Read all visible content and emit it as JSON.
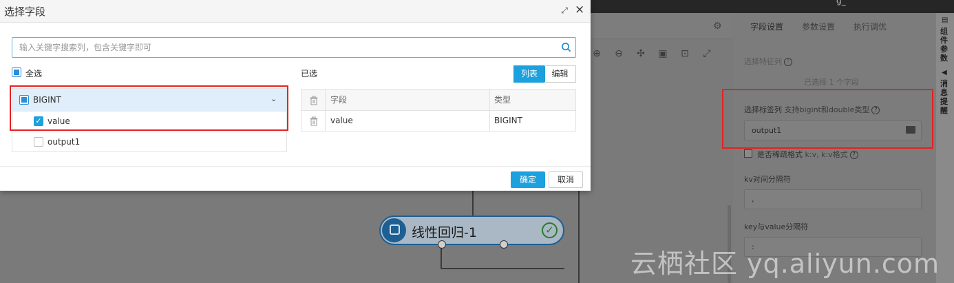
{
  "app": {
    "window_title": "g_",
    "right_panel": {
      "tabs": [
        "字段设置",
        "参数设置",
        "执行调优"
      ],
      "feature_label": "选择特征列",
      "feature_status": "已选择 1 个字段",
      "label_col_title": "选择标签列",
      "label_col_hint": "支持bigint和double类型",
      "label_col_value": "output1",
      "sparse_label": "是否稀疏格式",
      "sparse_hint": "k:v, k:v格式",
      "kv_sep_label": "kv对间分隔符",
      "kv_sep_value": ",",
      "key_value_sep_label": "key与value分隔符",
      "key_value_sep_value": ":"
    },
    "sidebar": {
      "item1": "组件参数",
      "item2": "消息提醒"
    },
    "node": {
      "label": "线性回归-1",
      "status": "✓"
    },
    "watermark": "云栖社区 yq.aliyun.com"
  },
  "dialog": {
    "title": "选择字段",
    "search_placeholder": "输入关键字搜索列，包含关键字即可",
    "select_all_label": "全选",
    "group_label": "BIGINT",
    "fields": [
      {
        "name": "value",
        "checked": true
      },
      {
        "name": "output1",
        "checked": false
      }
    ],
    "selected_title": "已选",
    "view_modes": [
      "列表",
      "编辑"
    ],
    "active_view": "列表",
    "table": {
      "headers": [
        "字段",
        "类型"
      ],
      "rows": [
        {
          "field": "value",
          "type": "BIGINT"
        }
      ]
    },
    "ok_label": "确定",
    "cancel_label": "取消"
  }
}
